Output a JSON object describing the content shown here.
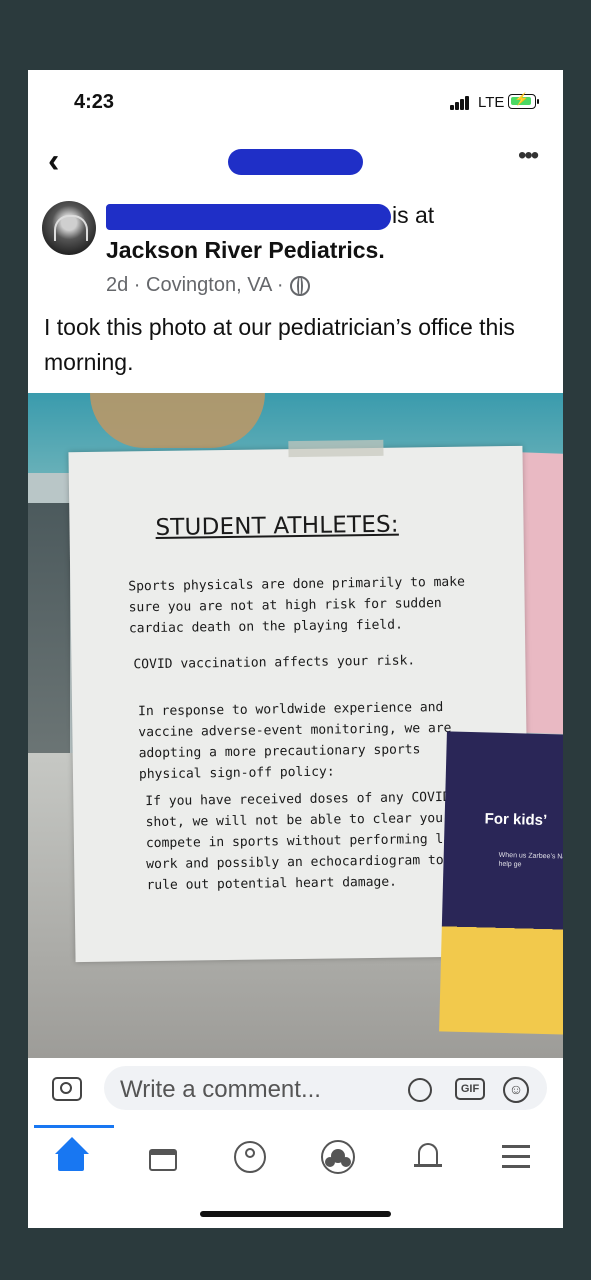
{
  "status_bar": {
    "time": "4:23",
    "network": "LTE"
  },
  "post": {
    "action_text": "is at",
    "place": "Jackson River Pediatrics.",
    "meta": "2d · Covington, VA ·",
    "caption": "I took this photo at our pediatrician’s office this morning."
  },
  "photo": {
    "sign": {
      "title": "STUDENT ATHLETES:",
      "paragraph_1": "Sports physicals are done primarily to make sure you are not at high risk for sudden cardiac death on the playing field.",
      "paragraph_2": "COVID vaccination affects your risk.",
      "paragraph_3": "In response to worldwide experience and vaccine adverse-event monitoring, we are adopting a more precautionary sports physical sign-off policy:",
      "paragraph_4": "If you have received doses of any COVID shot, we will not be able to clear you to compete in sports without performing lab work and possibly an echocardiogram to rule out potential heart damage."
    },
    "flyer": {
      "title": "For kids’",
      "small_text": "When us Zarbee’s Natur help ge"
    }
  },
  "comment": {
    "placeholder": "Write a comment...",
    "gif_label": "GIF"
  },
  "colors": {
    "accent": "#1877f2",
    "redaction": "#1f2fc7"
  }
}
